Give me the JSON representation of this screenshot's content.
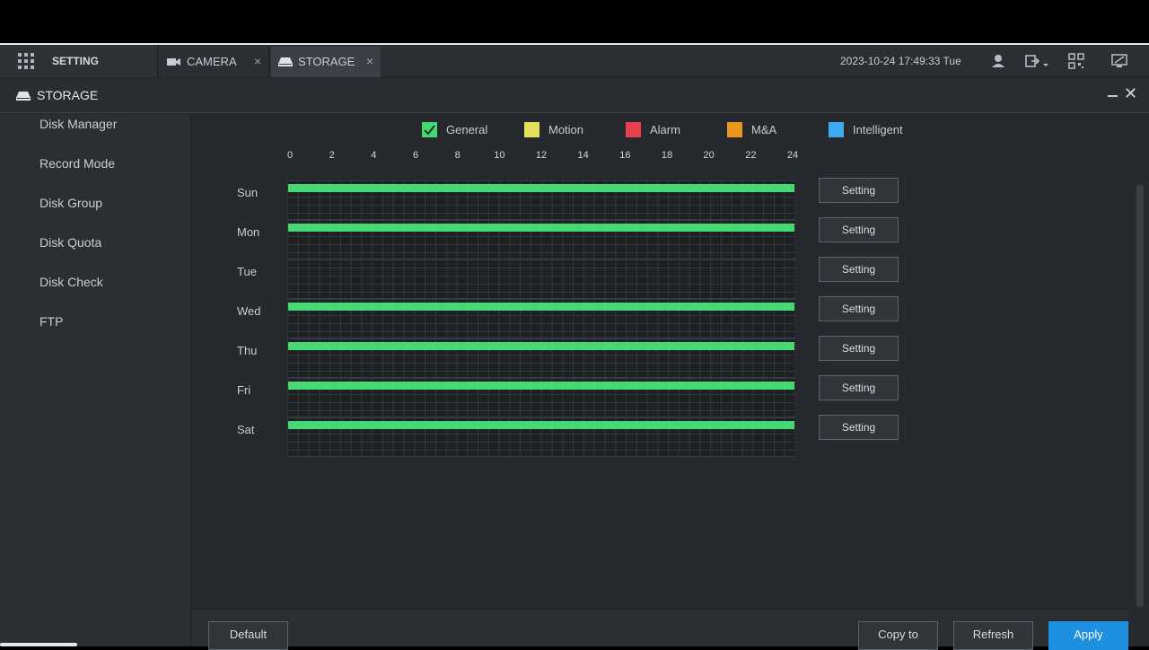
{
  "topbar": {
    "setting_label": "SETTING",
    "tabs": [
      {
        "label": "CAMERA",
        "icon": "camera-icon",
        "close": "×"
      },
      {
        "label": "STORAGE",
        "icon": "storage-icon",
        "close": "×"
      }
    ],
    "datetime": "2023-10-24 17:49:33 Tue"
  },
  "header": {
    "title": "STORAGE",
    "minimize": "",
    "close": "✕"
  },
  "sidebar": {
    "items": [
      {
        "label": "Disk Manager"
      },
      {
        "label": "Record Mode"
      },
      {
        "label": "Disk Group"
      },
      {
        "label": "Disk Quota"
      },
      {
        "label": "Disk Check"
      },
      {
        "label": "FTP"
      }
    ]
  },
  "legend": [
    {
      "label": "General",
      "color": "#46d873",
      "checked": true
    },
    {
      "label": "Motion",
      "color": "#e5df5e",
      "checked": false
    },
    {
      "label": "Alarm",
      "color": "#e8404f",
      "checked": false
    },
    {
      "label": "M&A",
      "color": "#e8961e",
      "checked": false
    },
    {
      "label": "Intelligent",
      "color": "#3eaaf0",
      "checked": false
    }
  ],
  "schedule": {
    "hours": [
      "0",
      "2",
      "4",
      "6",
      "8",
      "10",
      "12",
      "14",
      "16",
      "18",
      "20",
      "22",
      "24"
    ],
    "days": [
      {
        "label": "Sun",
        "general": [
          0,
          24
        ],
        "button": "Setting"
      },
      {
        "label": "Mon",
        "general": [
          0,
          24
        ],
        "button": "Setting"
      },
      {
        "label": "Tue",
        "general": null,
        "button": "Setting"
      },
      {
        "label": "Wed",
        "general": [
          0,
          24
        ],
        "button": "Setting"
      },
      {
        "label": "Thu",
        "general": [
          0,
          24
        ],
        "button": "Setting"
      },
      {
        "label": "Fri",
        "general": [
          0,
          24
        ],
        "button": "Setting"
      },
      {
        "label": "Sat",
        "general": [
          0,
          24
        ],
        "button": "Setting"
      }
    ]
  },
  "footer": {
    "default_label": "Default",
    "copy_label": "Copy to",
    "refresh_label": "Refresh",
    "apply_label": "Apply"
  }
}
